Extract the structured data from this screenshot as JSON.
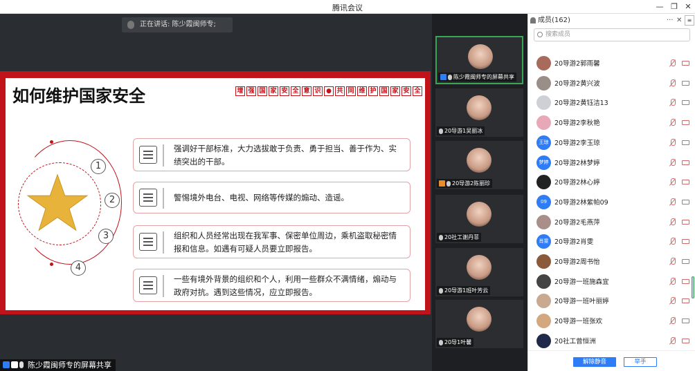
{
  "window": {
    "title": "腾讯会议",
    "minimize": "—",
    "restore": "❐",
    "close": "✕"
  },
  "stage": {
    "speaking": "正在讲话: 陈少霞闽师专;",
    "presenter_tag": "陈少霞闽师专的屏幕共享"
  },
  "slide": {
    "title": "如何维护国家安全",
    "slogan": [
      "增",
      "强",
      "国",
      "家",
      "安",
      "全",
      "意",
      "识",
      "●",
      "共",
      "同",
      "维",
      "护",
      "国",
      "家",
      "安",
      "全"
    ],
    "items": [
      {
        "num": "1",
        "text": "强调好干部标准，大力选拔敢于负责、勇于担当、善于作为、实绩突出的干部。"
      },
      {
        "num": "2",
        "text": "警惕境外电台、电视、网络等传媒的煽动、造谣。"
      },
      {
        "num": "3",
        "text": "组织和人员经常出现在我军事、保密单位周边，乘机盗取秘密情报和信息。如遇有可疑人员要立即报告。"
      },
      {
        "num": "4",
        "text": "一些有境外背景的组织和个人，利用一些群众不满情绪，煽动与政府对抗。遇到这些情况，应立即报告。"
      }
    ]
  },
  "videos": [
    {
      "label": "陈少霞闽师专的屏幕共享",
      "active": true
    },
    {
      "label": "20导游1吴丽冰"
    },
    {
      "label": "20导游2陈丽珍"
    },
    {
      "label": "20社工谢丹菲"
    },
    {
      "label": "20导游1班叶芳云"
    },
    {
      "label": "20导1叶馨"
    }
  ],
  "members": {
    "header": "成员(162)",
    "more": "···",
    "close": "✕",
    "menu": "≡",
    "search_placeholder": "搜索成员",
    "list": [
      {
        "name": "20导游2郭雨馨",
        "avatar": "",
        "color": "#a86a5a"
      },
      {
        "name": "20导游2黄兴波",
        "avatar": "",
        "color": "#9a8f88"
      },
      {
        "name": "20导游2黄钰洁13",
        "avatar": "",
        "color": "#cfcfd6"
      },
      {
        "name": "20导游2李秋艳",
        "avatar": "",
        "color": "#e7a9b7"
      },
      {
        "name": "20导游2李玉琼",
        "avatar": "王琼",
        "color": "#2f7df6"
      },
      {
        "name": "20导游2林梦婷",
        "avatar": "梦婷",
        "color": "#2f7df6"
      },
      {
        "name": "20导游2林心婷",
        "avatar": "",
        "color": "#222"
      },
      {
        "name": "20导游2林紫帕09",
        "avatar": "09",
        "color": "#2f7df6"
      },
      {
        "name": "20导游2毛燕萍",
        "avatar": "",
        "color": "#a98f8a"
      },
      {
        "name": "20导游2肖雯",
        "avatar": "肖雯",
        "color": "#2f7df6"
      },
      {
        "name": "20导游2周书怡",
        "avatar": "",
        "color": "#8a5a3a"
      },
      {
        "name": "20导游一班施森宜",
        "avatar": "",
        "color": "#444"
      },
      {
        "name": "20导游一班叶丽婷",
        "avatar": "",
        "color": "#c9a98f"
      },
      {
        "name": "20导游一班张欢",
        "avatar": "",
        "color": "#d4a87f"
      },
      {
        "name": "20社工曾恒洲",
        "avatar": "",
        "color": "#1f2a4a"
      }
    ],
    "unmute_label": "解除静音",
    "hand_label": "举手"
  }
}
